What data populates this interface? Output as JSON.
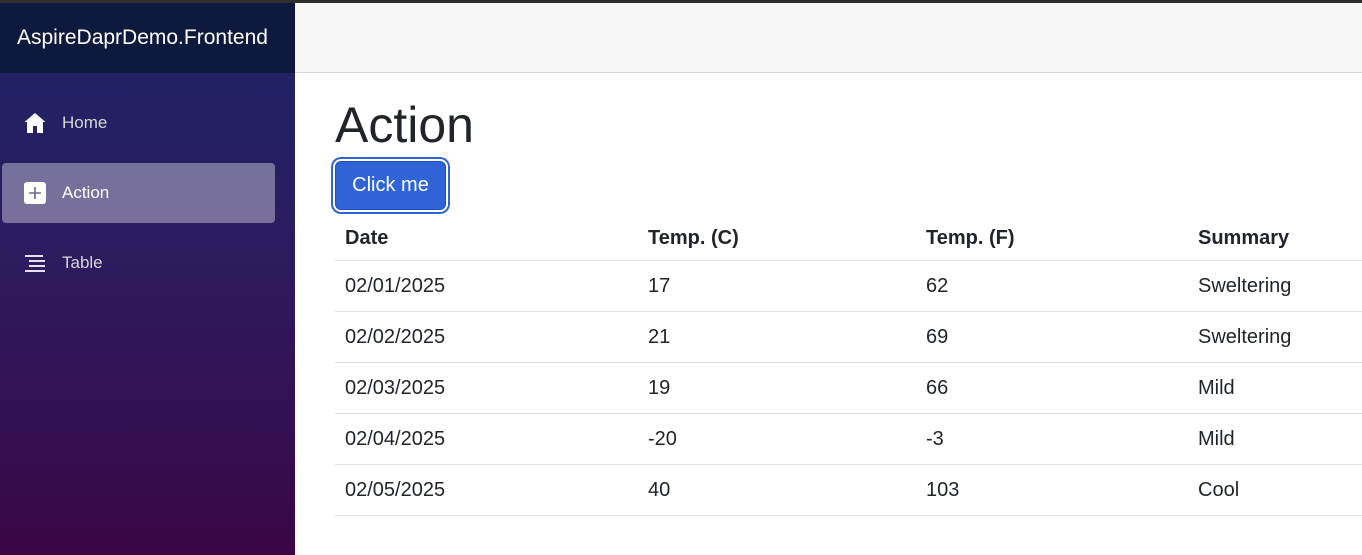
{
  "app": {
    "brand": "AspireDaprDemo.Frontend"
  },
  "sidebar": {
    "items": [
      {
        "label": "Home",
        "icon": "home-icon",
        "active": false
      },
      {
        "label": "Action",
        "icon": "plus-square-icon",
        "active": true
      },
      {
        "label": "Table",
        "icon": "list-icon",
        "active": false
      }
    ]
  },
  "main": {
    "title": "Action",
    "button_label": "Click me",
    "table": {
      "headers": [
        "Date",
        "Temp. (C)",
        "Temp. (F)",
        "Summary"
      ],
      "rows": [
        [
          "02/01/2025",
          "17",
          "62",
          "Sweltering"
        ],
        [
          "02/02/2025",
          "21",
          "69",
          "Sweltering"
        ],
        [
          "02/03/2025",
          "19",
          "66",
          "Mild"
        ],
        [
          "02/04/2025",
          "-20",
          "-3",
          "Mild"
        ],
        [
          "02/05/2025",
          "40",
          "103",
          "Cool"
        ]
      ]
    }
  },
  "colors": {
    "brand_bar": "#0d1a3e",
    "sidebar_top": "#1d2367",
    "sidebar_bottom": "#3a0647",
    "button": "#2f63d6"
  }
}
